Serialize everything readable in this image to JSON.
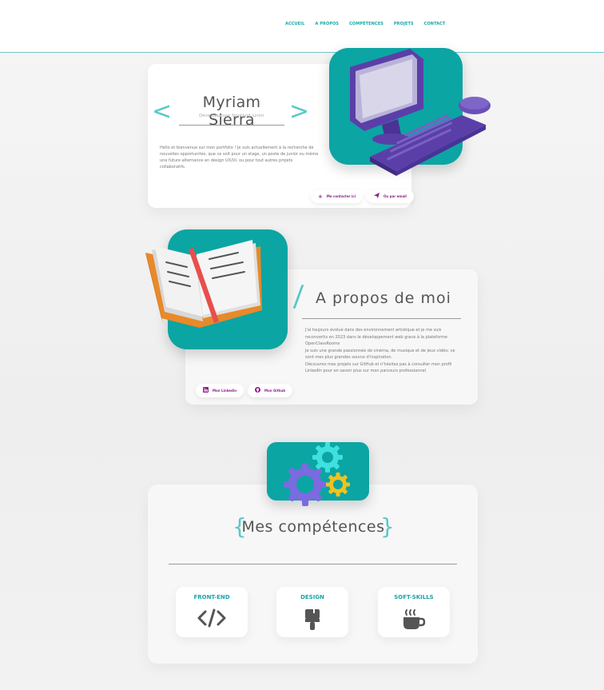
{
  "nav": {
    "items": [
      "ACCUEIL",
      "A PROPOS",
      "COMPÉTENCES",
      "PROJETS",
      "CONTACT"
    ]
  },
  "hero": {
    "name": "Myriam Sierra",
    "subtitle": "Développeuse frontend junior",
    "description": "Hello et bienvenue sur mon portfolio ! Je suis actuellement à la recherche de nouvelles opportunités, que ce soit pour un stage, un poste de junior ou même une future alternance en design UX/UI, ou pour tout autres projets collaboratifs.",
    "buttons": {
      "contact": "Me contacter ici",
      "email": "Ou par email"
    }
  },
  "about": {
    "title": "A propos de moi",
    "paragraphs": [
      "J'ai toujours évolué dans des environnement artistique et je me suis reconvertis en 2023 dans le développement web grace à la plateforme OpenClassRooms",
      "Je suis une grande passionnée de cinéma, de musique et de jeux vidéo; ce sont mes plus grandes source d'inspiration.",
      "Découvrez mes projets sur GitHub et n'hésitez pas à consulter mon profil LinkedIn pour en savoir plus sur mon parcours professionnel"
    ],
    "buttons": {
      "linkedin": "Mon Linkedin",
      "github": "Mon Github"
    }
  },
  "skills": {
    "title": "Mes compétences",
    "items": [
      {
        "label": "FRONT-END",
        "icon": "code-icon"
      },
      {
        "label": "DESIGN",
        "icon": "paintbrush-icon"
      },
      {
        "label": "SOFT-SKILLS",
        "icon": "coffee-icon"
      }
    ]
  },
  "colors": {
    "accent": "#0ba5a3",
    "accent_light": "#5cc8c6",
    "pill_text": "#8a1f8a",
    "nav_text": "#17a6a8"
  }
}
